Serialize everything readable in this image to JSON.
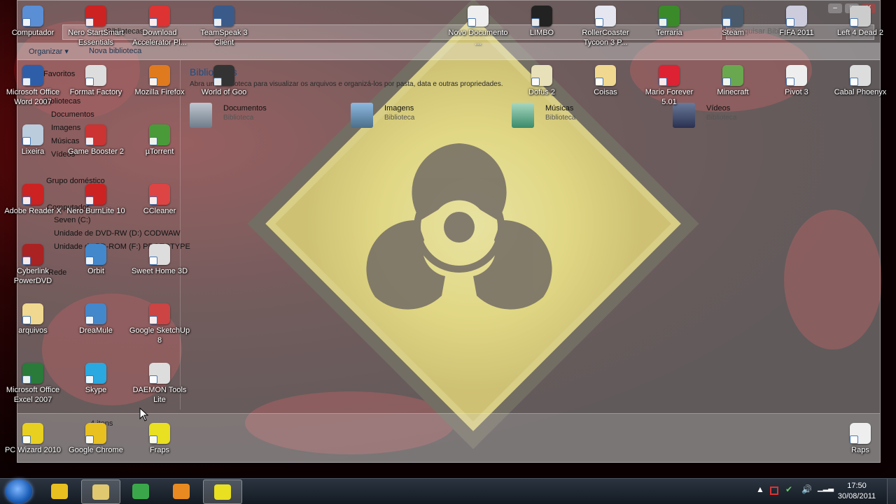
{
  "desktop_icons": [
    {
      "label": "Computador",
      "icon": "computer-icon",
      "color": "#5a8fd6"
    },
    {
      "label": "Nero StartSmart Essentials",
      "icon": "nero-icon",
      "color": "#c22"
    },
    {
      "label": "Download Accelerator Pl...",
      "icon": "dap-icon",
      "color": "#d33"
    },
    {
      "label": "TeamSpeak 3 Client",
      "icon": "teamspeak-icon",
      "color": "#3a5a8a"
    },
    {
      "label": "Novo Documento ...",
      "icon": "document-icon",
      "color": "#eee"
    },
    {
      "label": "LIMBO",
      "icon": "limbo-icon",
      "color": "#222"
    },
    {
      "label": "RollerCoaster Tycoon 3 P...",
      "icon": "rollercoaster-icon",
      "color": "#e6e6f0"
    },
    {
      "label": "Terraria",
      "icon": "terraria-icon",
      "color": "#3a8a2a"
    },
    {
      "label": "Steam",
      "icon": "steam-icon",
      "color": "#4a5a6a"
    },
    {
      "label": "FIFA 2011",
      "icon": "fifa-icon",
      "color": "#ccd"
    },
    {
      "label": "Left 4 Dead 2",
      "icon": "left4dead-icon",
      "color": "#ccc"
    },
    {
      "label": "Microsoft Office Word 2007",
      "icon": "word-icon",
      "color": "#2f5ea8"
    },
    {
      "label": "Format Factory",
      "icon": "formatfactory-icon",
      "color": "#ddd"
    },
    {
      "label": "Mozilla Firefox",
      "icon": "firefox-icon",
      "color": "#e07a1f"
    },
    {
      "label": "World of Goo",
      "icon": "worldofgoo-icon",
      "color": "#333"
    },
    {
      "label": "Dofus 2",
      "icon": "dofus-icon",
      "color": "#e8e0b8"
    },
    {
      "label": "Coisas",
      "icon": "folder-icon",
      "color": "#f0d890"
    },
    {
      "label": "Mario Forever 5.01",
      "icon": "mario-icon",
      "color": "#d23"
    },
    {
      "label": "Minecraft",
      "icon": "minecraft-icon",
      "color": "#6aa84f"
    },
    {
      "label": "Pivot 3",
      "icon": "pivot-icon",
      "color": "#eee"
    },
    {
      "label": "Cabal Phoenyx",
      "icon": "cabal-icon",
      "color": "#ddd"
    },
    {
      "label": "Lixeira",
      "icon": "recycle-bin-icon",
      "color": "#bcd"
    },
    {
      "label": "Game Booster 2",
      "icon": "gamebooster-icon",
      "color": "#c33"
    },
    {
      "label": "µTorrent",
      "icon": "utorrent-icon",
      "color": "#4a9a3a"
    },
    {
      "label": "Adobe Reader X",
      "icon": "adobe-reader-icon",
      "color": "#c22"
    },
    {
      "label": "Nero BurnLite 10",
      "icon": "nero-burnlite-icon",
      "color": "#c22"
    },
    {
      "label": "CCleaner",
      "icon": "ccleaner-icon",
      "color": "#d44"
    },
    {
      "label": "Cyberlink PowerDVD",
      "icon": "powerdvd-icon",
      "color": "#a22"
    },
    {
      "label": "Orbit",
      "icon": "orbit-icon",
      "color": "#48c"
    },
    {
      "label": "Sweet Home 3D",
      "icon": "sweethome-icon",
      "color": "#ddd"
    },
    {
      "label": "arquivos",
      "icon": "folder-icon",
      "color": "#f0d890"
    },
    {
      "label": "DreaMule",
      "icon": "dreamule-icon",
      "color": "#48c"
    },
    {
      "label": "Google SketchUp 8",
      "icon": "sketchup-icon",
      "color": "#c44"
    },
    {
      "label": "Microsoft Office Excel 2007",
      "icon": "excel-icon",
      "color": "#2a7a3a"
    },
    {
      "label": "Skype",
      "icon": "skype-icon",
      "color": "#2aa8e0"
    },
    {
      "label": "DAEMON Tools Lite",
      "icon": "daemon-tools-icon",
      "color": "#ddd"
    },
    {
      "label": "PC Wizard 2010",
      "icon": "pcwizard-icon",
      "color": "#e8d020"
    },
    {
      "label": "Google Chrome",
      "icon": "chrome-icon",
      "color": "#e8c020"
    },
    {
      "label": "Fraps",
      "icon": "fraps-icon",
      "color": "#e8e020"
    },
    {
      "label": "Raps",
      "icon": "document-icon",
      "color": "#eee"
    }
  ],
  "explorer": {
    "address": "Bibliotecas",
    "search_placeholder": "Pesquisar Bibliotecas",
    "organize": "Organizar ▾",
    "new_library": "Nova biblioteca",
    "nav": {
      "favorites": "Favoritos",
      "libraries": "Bibliotecas",
      "documents": "Documentos",
      "images": "Imagens",
      "music": "Músicas",
      "videos": "Vídeos",
      "homegroup": "Grupo doméstico",
      "computer": "Computador",
      "drive_c": "Seven (C:)",
      "drive_d": "Unidade de DVD-RW (D:) CODWAW",
      "drive_f": "Unidade de BD-ROM (F:) PROTOTYPE",
      "network": "Rede"
    },
    "content_title": "Bibliotecas",
    "content_subtitle": "Abra uma biblioteca para visualizar os arquivos e organizá-los por pasta, data e outras propriedades.",
    "libraries": [
      {
        "name": "Documentos",
        "type": "Biblioteca"
      },
      {
        "name": "Imagens",
        "type": "Biblioteca"
      },
      {
        "name": "Músicas",
        "type": "Biblioteca"
      },
      {
        "name": "Vídeos",
        "type": "Biblioteca"
      }
    ],
    "status": "4 itens"
  },
  "taskbar": {
    "apps": [
      {
        "icon": "chrome-icon",
        "color": "#e8c020",
        "active": false
      },
      {
        "icon": "explorer-icon",
        "color": "#e0c870",
        "active": true
      },
      {
        "icon": "messenger-icon",
        "color": "#3aa84a",
        "active": false
      },
      {
        "icon": "media-player-icon",
        "color": "#e88a20",
        "active": false
      },
      {
        "icon": "fraps-icon",
        "color": "#e8e020",
        "active": true
      }
    ],
    "time": "17:50",
    "date": "30/08/2011"
  }
}
